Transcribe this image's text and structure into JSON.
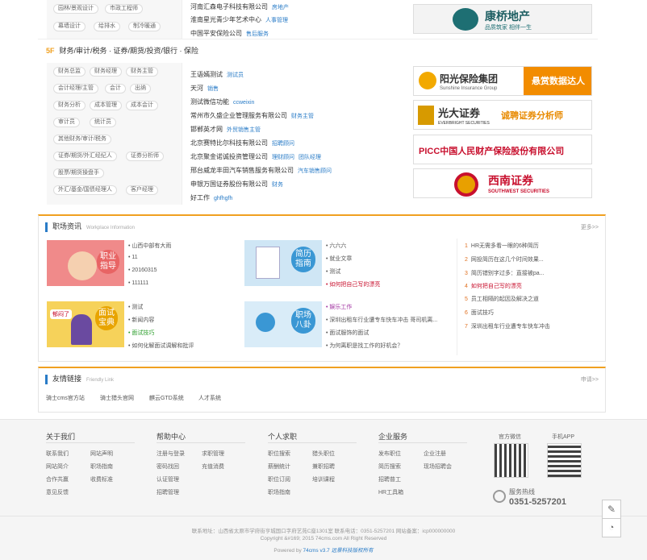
{
  "top": {
    "tags": [
      "园林/景观设计",
      "市政工程师",
      "幕墙设计",
      "给排水",
      "制冷暖通"
    ],
    "companies": [
      {
        "name": "河南汇森电子科技有限公司",
        "job": "房地产"
      },
      {
        "name": "淮南星光青少年艺术中心",
        "job": "人事管理"
      },
      {
        "name": "中国平安保险公司",
        "job": "售后服务"
      }
    ],
    "ad": {
      "name": "康桥地产",
      "slogan": "品质筑家 相伴一生"
    }
  },
  "floor5": {
    "num": "5F",
    "title": "财务/审计/税务 · 证券/期货/投资/银行 · 保险",
    "tags": [
      "财务总监",
      "财务经理",
      "财务主管",
      "会计经理/主管",
      "会计",
      "出纳",
      "财务分析",
      "成本管理",
      "成本会计",
      "审计员",
      "统计员",
      "其他财务/审计/税务",
      "证券/期货/外汇经纪人",
      "证券分析师",
      "股票/期货操盘手",
      "外汇/基金/国债经理人",
      "客户经理"
    ],
    "companies": [
      {
        "name": "王语嫣测试",
        "jobs": [
          "测试员"
        ]
      },
      {
        "name": "天河",
        "jobs": [
          "销售"
        ]
      },
      {
        "name": "测试微信功能",
        "jobs": [
          "ccweixin"
        ]
      },
      {
        "name": "常州市久盛企业管理服务有限公司",
        "jobs": [
          "财务主管"
        ]
      },
      {
        "name": "邯郸英才网",
        "jobs": [
          "外贸销售主管"
        ]
      },
      {
        "name": "北京赛特比尔科技有限公司",
        "jobs": [
          "招聘顾问"
        ]
      },
      {
        "name": "北京聚金诺诚投资管理公司",
        "jobs": [
          "理财顾问",
          "团队经理"
        ]
      },
      {
        "name": "邢台威龙丰田汽车销售服务有限公司",
        "jobs": [
          "汽车销售顾问"
        ]
      },
      {
        "name": "申银万国证券股份有限公司",
        "jobs": [
          "财务"
        ]
      },
      {
        "name": "好工作",
        "jobs": [
          "ghfhgfh"
        ]
      }
    ],
    "ads": [
      {
        "name": "阳光保险集团",
        "sub": "Sunshine Insurance Group",
        "tag": "悬赏数据达人"
      },
      {
        "name": "光大证券",
        "sub": "EVERBRIGHT SECURITIES",
        "tag": "诚聘证券分析师"
      },
      {
        "name": "PICC中国人民财产保险股份有限公司"
      },
      {
        "name": "西南证券",
        "sub": "SOUTHWEST SECURITIES"
      }
    ]
  },
  "news": {
    "title": "职场资讯",
    "subtitle": "Workplace Information",
    "more": "更多>>",
    "cards": [
      {
        "label": "职业指导",
        "items": [
          "山西中部有大雨",
          "11",
          "20160315",
          "111111"
        ]
      },
      {
        "label": "简历指南",
        "items": [
          "六六六",
          "就业文章",
          "测试",
          "如何把自己写的漂亮"
        ]
      },
      {
        "label": "面试宝典",
        "badge": "郁闷了",
        "items": [
          "测试",
          "新闻内容",
          "面试技巧",
          "如何化解面试调解和批评"
        ]
      },
      {
        "label": "职场八卦",
        "items": [
          "娱乐工作",
          "深圳出租车行业遭专车快车冲击 哥司机离...",
          "面试服饰的面试",
          "为何离职是找工作的好机会？"
        ]
      }
    ],
    "ranked": [
      "HR无需多看一眼的6种简历",
      "网投简历在这几个时间效果...",
      "简历错别字过多：直接被pa...",
      "如何把自己写的漂亮",
      "员工相隔的起因及解决之道",
      "面试技巧",
      "深圳出租车行业遭专车快车冲击"
    ]
  },
  "links": {
    "title": "友情链接",
    "subtitle": "Friendly Link",
    "apply": "申请>>",
    "items": [
      "骑士cms官方站",
      "骑士猎头官网",
      "麒云GTD系统",
      "人才系统"
    ]
  },
  "footer": {
    "cols": [
      {
        "title": "关于我们",
        "items": [
          "联系我们",
          "网站声明",
          "网站简介",
          "职场指南",
          "合作共赢",
          "收费标准",
          "意见反馈"
        ]
      },
      {
        "title": "帮助中心",
        "items": [
          "注册与登录",
          "求职管理",
          "密码找回",
          "充值消费",
          "认证管理",
          "招聘管理"
        ]
      },
      {
        "title": "个人求职",
        "items": [
          "职位搜索",
          "猎头职位",
          "薪酬统计",
          "兼职招聘",
          "职位订阅",
          "培训课程",
          "职场指南"
        ]
      },
      {
        "title": "企业服务",
        "items": [
          "发布职位",
          "企业注册",
          "简历搜索",
          "现场招聘会",
          "招聘普工",
          "HR工具箱"
        ]
      }
    ],
    "wechat": "官方微信",
    "app": "手机APP",
    "hotline_label": "服务热线",
    "hotline": "0351-5257201",
    "addr": "联系地址：山西省太原市学府街亨城国口字府艺苑C座1301室 联系电话：0351-5257201 网站备案：icp000000000",
    "copy": "Copyright &#169; 2015 74cms.com All Right Reserved",
    "powered": "Powered by",
    "powered_ver": "74cms v3.7",
    "powered_co": "远景科技版权所有"
  },
  "colors": {
    "accent": "#2a7cc7",
    "orange": "#f0a020"
  }
}
